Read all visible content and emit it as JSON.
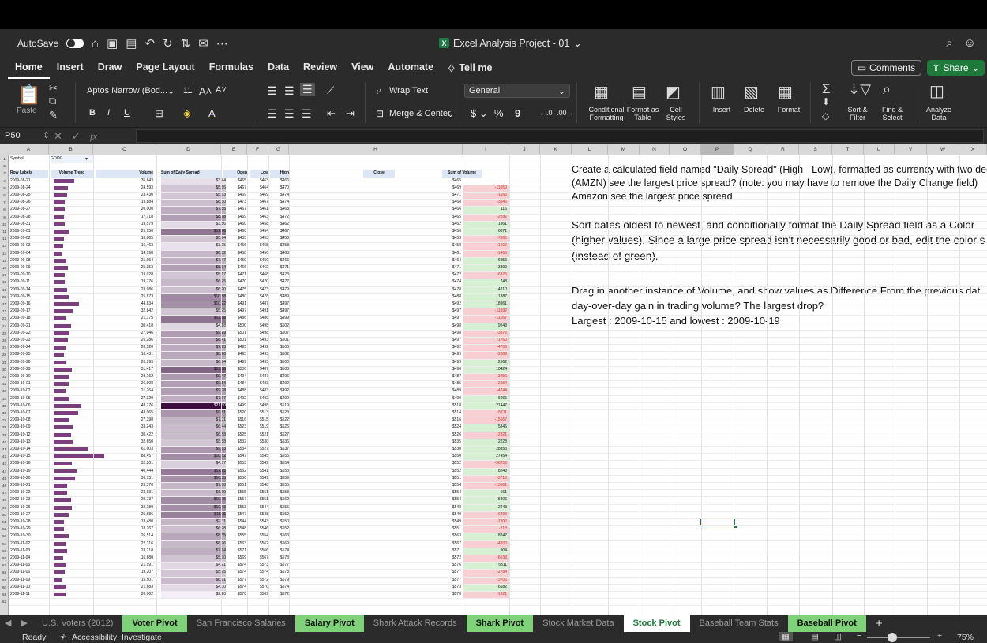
{
  "titlebar": {
    "autosave_label": "AutoSave",
    "doc_title": "Excel Analysis Project - 01"
  },
  "menu": {
    "tabs": [
      "Home",
      "Insert",
      "Draw",
      "Page Layout",
      "Formulas",
      "Data",
      "Review",
      "View",
      "Automate"
    ],
    "tell_me": "Tell me",
    "comments": "Comments",
    "share": "Share"
  },
  "ribbon": {
    "paste": "Paste",
    "font_name": "Aptos Narrow (Bod...",
    "font_size": "11",
    "wrap_text": "Wrap Text",
    "merge_center": "Merge & Center",
    "number_format": "General",
    "conditional_formatting": "Conditional Formatting",
    "format_as_table": "Format as Table",
    "cell_styles": "Cell Styles",
    "insert": "Insert",
    "delete": "Delete",
    "format": "Format",
    "sort_filter": "Sort & Filter",
    "find_select": "Find & Select",
    "analyze_data": "Analyze Data"
  },
  "formula_bar": {
    "name_box": "P50",
    "fx": "fx",
    "formula": ""
  },
  "columns": [
    "A",
    "B",
    "C",
    "D",
    "E",
    "F",
    "G",
    "H",
    "I",
    "J",
    "K",
    "L",
    "M",
    "N",
    "O",
    "P",
    "Q",
    "R",
    "S",
    "T",
    "U",
    "V",
    "W",
    "X"
  ],
  "selected_column": "P",
  "pivot": {
    "symbol_label": "Symbol",
    "symbol_value": "GOOG",
    "headers": [
      "Row Labels",
      "Volume Trend",
      "Volume",
      "Sum of Daily Spread",
      "Open",
      "Low",
      "High",
      "Close",
      "Sum of Volume"
    ],
    "rows": [
      [
        "2009-08-21",
        "35,643",
        "$3.44",
        "$465",
        "$463",
        "$466",
        "$465",
        ""
      ],
      [
        "2009-08-24",
        "24,593",
        "$5.66",
        "$467",
        "$464",
        "$470",
        "$469",
        "-11050"
      ],
      [
        "2009-08-25",
        "23,430",
        "$5.63",
        "$469",
        "$469",
        "$474",
        "$471",
        "-1163"
      ],
      [
        "2009-08-26",
        "19,884",
        "$6.30",
        "$473",
        "$467",
        "$474",
        "$468",
        "-3546"
      ],
      [
        "2009-08-27",
        "20,000",
        "$7.85",
        "$467",
        "$461",
        "$468",
        "$466",
        "116"
      ],
      [
        "2009-08-28",
        "17,718",
        "$8.98",
        "$469",
        "$463",
        "$472",
        "$465",
        "-2282"
      ],
      [
        "2009-08-31",
        "19,579",
        "$3.86",
        "$460",
        "$458",
        "$462",
        "$462",
        "1861"
      ],
      [
        "2009-09-01",
        "25,950",
        "$12.40",
        "$460",
        "$454",
        "$467",
        "$456",
        "6371"
      ],
      [
        "2009-09-02",
        "18,085",
        "$5.74",
        "$455",
        "$453",
        "$458",
        "$453",
        "-7865"
      ],
      [
        "2009-09-03",
        "16,463",
        "$3.25",
        "$456",
        "$455",
        "$458",
        "$458",
        "-1602"
      ],
      [
        "2009-09-04",
        "14,998",
        "$6.82",
        "$458",
        "$456",
        "$463",
        "$461",
        "-1465"
      ],
      [
        "2009-09-08",
        "21,954",
        "$7.47",
        "$459",
        "$459",
        "$466",
        "$464",
        "6956"
      ],
      [
        "2009-09-09",
        "25,353",
        "$8.94",
        "$466",
        "$462",
        "$471",
        "$471",
        "3399"
      ],
      [
        "2009-09-10",
        "19,028",
        "$5.67",
        "$471",
        "$468",
        "$473",
        "$472",
        "-6325"
      ],
      [
        "2009-09-11",
        "19,776",
        "$6.75",
        "$470",
        "$470",
        "$477",
        "$474",
        "748"
      ],
      [
        "2009-09-14",
        "23,986",
        "$6.20",
        "$475",
        "$473",
        "$479",
        "$478",
        "4210"
      ],
      [
        "2009-09-15",
        "25,873",
        "$10.88",
        "$480",
        "$478",
        "$489",
        "$488",
        "1887"
      ],
      [
        "2009-09-16",
        "44,834",
        "$10.22",
        "$491",
        "$487",
        "$497",
        "$492",
        "18961"
      ],
      [
        "2009-09-17",
        "32,842",
        "$5.75",
        "$497",
        "$491",
        "$497",
        "$497",
        "-11992"
      ],
      [
        "2009-09-18",
        "21,175",
        "$12.68",
        "$486",
        "$486",
        "$499",
        "$497",
        "-11667"
      ],
      [
        "2009-09-21",
        "30,418",
        "$4.18",
        "$500",
        "$498",
        "$502",
        "$498",
        "9243"
      ],
      [
        "2009-09-22",
        "27,046",
        "$9.29",
        "$501",
        "$498",
        "$507",
        "$498",
        "-3372"
      ],
      [
        "2009-09-23",
        "25,286",
        "$8.41",
        "$501",
        "$493",
        "$501",
        "$497",
        "-1760"
      ],
      [
        "2009-09-24",
        "20,520",
        "$7.93",
        "$495",
        "$492",
        "$500",
        "$492",
        "-4766"
      ],
      [
        "2009-09-25",
        "18,431",
        "$8.20",
        "$495",
        "$493",
        "$502",
        "$499",
        "-2089"
      ],
      [
        "2009-09-28",
        "20,993",
        "$6.74",
        "$499",
        "$493",
        "$500",
        "$499",
        "2562"
      ],
      [
        "2009-09-29",
        "31,417",
        "$13.98",
        "$500",
        "$487",
        "$500",
        "$496",
        "10424"
      ],
      [
        "2009-09-30",
        "28,162",
        "$9.47",
        "$494",
        "$487",
        "$496",
        "$487",
        "-3255"
      ],
      [
        "2009-10-01",
        "26,008",
        "$9.14",
        "$484",
        "$483",
        "$492",
        "$485",
        "-2154"
      ],
      [
        "2009-10-02",
        "21,264",
        "$9.08",
        "$488",
        "$483",
        "$492",
        "$489",
        "-4744"
      ],
      [
        "2009-10-05",
        "27,329",
        "$7.67",
        "$492",
        "$492",
        "$499",
        "$499",
        "6065"
      ],
      [
        "2009-10-06",
        "48,776",
        "$21.30",
        "$499",
        "$498",
        "$519",
        "$518",
        "21447"
      ],
      [
        "2009-10-07",
        "43,065",
        "$9.81",
        "$520",
        "$513",
        "$523",
        "$514",
        "-5711"
      ],
      [
        "2009-10-08",
        "27,398",
        "$7.01",
        "$516",
        "$515",
        "$522",
        "$516",
        "-15667"
      ],
      [
        "2009-10-09",
        "33,243",
        "$6.44",
        "$523",
        "$519",
        "$526",
        "$524",
        "5845"
      ],
      [
        "2009-10-12",
        "30,422",
        "$6.58",
        "$525",
        "$521",
        "$527",
        "$526",
        "-2821"
      ],
      [
        "2009-10-13",
        "32,650",
        "$5.58",
        "$532",
        "$530",
        "$536",
        "$535",
        "2228"
      ],
      [
        "2009-10-14",
        "61,003",
        "$9.63",
        "$534",
        "$527",
        "$537",
        "$530",
        "28353"
      ],
      [
        "2009-10-15",
        "88,457",
        "$10.52",
        "$547",
        "$545",
        "$555",
        "$550",
        "27454"
      ],
      [
        "2009-10-16",
        "32,201",
        "$4.87",
        "$553",
        "$549",
        "$554",
        "$552",
        "-56256"
      ],
      [
        "2009-10-19",
        "40,444",
        "$12.25",
        "$552",
        "$541",
        "$553",
        "$552",
        "8243"
      ],
      [
        "2009-10-20",
        "36,731",
        "$10.35",
        "$550",
        "$549",
        "$559",
        "$551",
        "-3713"
      ],
      [
        "2009-10-21",
        "23,370",
        "$7.00",
        "$551",
        "$548",
        "$555",
        "$554",
        "-13361"
      ],
      [
        "2009-10-22",
        "23,931",
        "$6.69",
        "$555",
        "$551",
        "$558",
        "$554",
        "561"
      ],
      [
        "2009-10-23",
        "29,737",
        "$10.75",
        "$557",
        "$551",
        "$562",
        "$554",
        "5806"
      ],
      [
        "2009-10-26",
        "32,180",
        "$10.43",
        "$553",
        "$544",
        "$555",
        "$548",
        "2443"
      ],
      [
        "2009-10-27",
        "25,686",
        "$11.75",
        "$547",
        "$538",
        "$550",
        "$540",
        "-6494"
      ],
      [
        "2009-10-28",
        "18,480",
        "$7.11",
        "$544",
        "$543",
        "$550",
        "$549",
        "-7206"
      ],
      [
        "2009-10-29",
        "18,267",
        "$6.28",
        "$548",
        "$546",
        "$552",
        "$551",
        "-213"
      ],
      [
        "2009-10-30",
        "26,514",
        "$8.35",
        "$555",
        "$554",
        "$563",
        "$563",
        "8247"
      ],
      [
        "2009-11-02",
        "22,316",
        "$6.76",
        "$563",
        "$562",
        "$569",
        "$567",
        "-4200"
      ],
      [
        "2009-11-03",
        "23,218",
        "$7.64",
        "$571",
        "$566",
        "$574",
        "$571",
        "904"
      ],
      [
        "2009-11-04",
        "16,680",
        "$5.90",
        "$569",
        "$567",
        "$573",
        "$572",
        "-6538"
      ],
      [
        "2009-11-05",
        "21,991",
        "$4.21",
        "$574",
        "$573",
        "$577",
        "$576",
        "5311"
      ],
      [
        "2009-11-06",
        "19,207",
        "$5.75",
        "$574",
        "$574",
        "$578",
        "$577",
        "-2784"
      ],
      [
        "2009-11-09",
        "15,501",
        "$6.71",
        "$577",
        "$572",
        "$579",
        "$577",
        "-3706"
      ],
      [
        "2009-11-10",
        "21,683",
        "$4.00",
        "$574",
        "$570",
        "$574",
        "$573",
        "6182"
      ],
      [
        "2009-11-11",
        "20,062",
        "$2.20",
        "$570",
        "$569",
        "$572",
        "$570",
        "-1621"
      ]
    ]
  },
  "row_numbers": [
    "1",
    "2",
    "3",
    "4",
    "5",
    "6",
    "7",
    "8",
    "9",
    "10",
    "11",
    "12",
    "13",
    "14",
    "15",
    "16",
    "17",
    "18",
    "19",
    "20",
    "21",
    "22",
    "23",
    "24",
    "25",
    "26",
    "27",
    "28",
    "29",
    "30",
    "31",
    "32",
    "33",
    "34",
    "35",
    "36",
    "37",
    "38",
    "39",
    "40",
    "41",
    "42",
    "43",
    "44",
    "45",
    "46",
    "47",
    "48",
    "49",
    "50",
    "51",
    "52",
    "53",
    "54",
    "55",
    "56",
    "57",
    "58",
    "59",
    "60",
    "61",
    "62"
  ],
  "notes": {
    "task1_line1": "Create a calculated field named \"Daily Spread\" (High - Low), formatted as currency with two decimal pla",
    "task1_line2": "(AMZN) see the largest price spread? (note: you may have to remove the Daily Change field)",
    "task1_line3": "Amazon see the largest price spread.",
    "task2_line1": "Sort dates oldest to newest, and conditionally format the Daily Spread field as a Color",
    "task2_line2": "(higher values). Since a large price spread isn't necessarily good or bad, edit the color s",
    "task2_line3": "(instead of green).",
    "task3_line1": "Drag in another instance of Volume, and show values as Difference From the previous dat",
    "task3_line2": "day-over-day gain in trading volume? The largest drop?",
    "task3_line3": "Largest : 2009-10-15 and lowest : 2009-10-19"
  },
  "sheets": [
    {
      "name": "U.S. Voters (2012)",
      "style": "plain"
    },
    {
      "name": "Voter Pivot",
      "style": "green"
    },
    {
      "name": "San Francisco Salaries",
      "style": "plain"
    },
    {
      "name": "Salary Pivot",
      "style": "green"
    },
    {
      "name": "Shark Attack Records",
      "style": "plain"
    },
    {
      "name": "Shark Pivot",
      "style": "green"
    },
    {
      "name": "Stock Market Data",
      "style": "plain"
    },
    {
      "name": "Stock Pivot",
      "style": "active"
    },
    {
      "name": "Baseball Team Stats",
      "style": "plain"
    },
    {
      "name": "Baseball Pivot",
      "style": "green"
    }
  ],
  "status": {
    "ready": "Ready",
    "accessibility": "Accessibility: Investigate",
    "zoom": "75%"
  },
  "colors": {
    "accent": "#1d7a3b",
    "bar": "#7b3f7e",
    "positive_fill": "#d7f0d3",
    "negative_fill": "#f8cfd2",
    "negative_text": "#c0392b"
  }
}
